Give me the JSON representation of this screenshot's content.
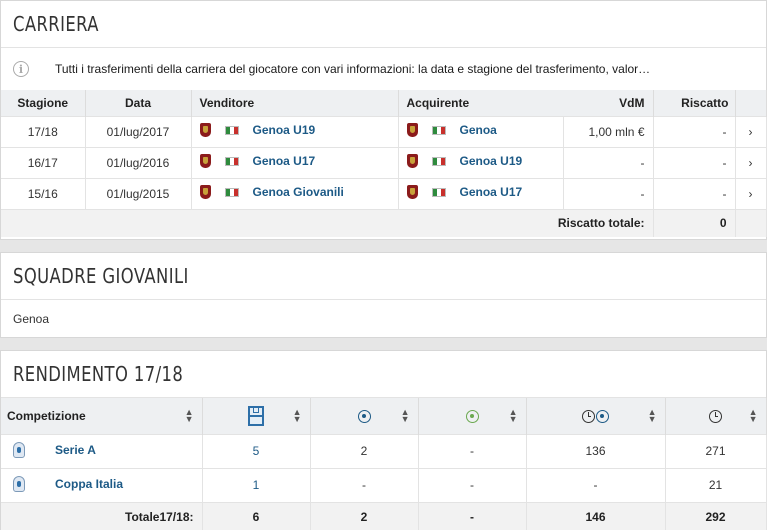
{
  "carriera": {
    "title": "Carriera",
    "info_text": "Tutti i trasferimenti della carriera del giocatore con vari informazioni: la data e stagione del trasferimento, valor…",
    "headers": {
      "stagione": "Stagione",
      "data": "Data",
      "venditore": "Venditore",
      "acquirente": "Acquirente",
      "vdm": "VdM",
      "riscatto": "Riscatto"
    },
    "rows": [
      {
        "stagione": "17/18",
        "data": "01/lug/2017",
        "venditore": "Genoa U19",
        "acquirente": "Genoa",
        "vdm": "1,00 mln €",
        "riscatto": "-"
      },
      {
        "stagione": "16/17",
        "data": "01/lug/2016",
        "venditore": "Genoa U17",
        "acquirente": "Genoa U19",
        "vdm": "-",
        "riscatto": "-"
      },
      {
        "stagione": "15/16",
        "data": "01/lug/2015",
        "venditore": "Genoa Giovanili",
        "acquirente": "Genoa U17",
        "vdm": "-",
        "riscatto": "-"
      }
    ],
    "total_label": "Riscatto totale:",
    "total_value": "0",
    "chevron": "›"
  },
  "giovanili": {
    "title": "Squadre giovanili",
    "team": "Genoa"
  },
  "rendimento": {
    "title": "Rendimento 17/18",
    "header_competizione": "Competizione",
    "rows": [
      {
        "competizione": "Serie A",
        "presenze": "5",
        "gol": "2",
        "assist": "-",
        "min_per_gol": "136",
        "minuti": "271"
      },
      {
        "competizione": "Coppa Italia",
        "presenze": "1",
        "gol": "-",
        "assist": "-",
        "min_per_gol": "-",
        "minuti": "21"
      }
    ],
    "total": {
      "label": "Totale17/18:",
      "presenze": "6",
      "gol": "2",
      "assist": "-",
      "min_per_gol": "146",
      "minuti": "292"
    }
  },
  "colors": {
    "link": "#1d5a86",
    "header_bg": "#eef0f2",
    "chevron": "#6cb7d6",
    "genoa_red": "#8b1b1b"
  },
  "icons": {
    "info": "info-icon",
    "sort": "sort-icon",
    "chevron": "chevron-right-icon",
    "presenze": "pitch-icon",
    "gol": "ball-icon",
    "assist": "assist-ball-icon",
    "min_per_gol": "clock-ball-icon",
    "minuti": "clock-icon"
  }
}
